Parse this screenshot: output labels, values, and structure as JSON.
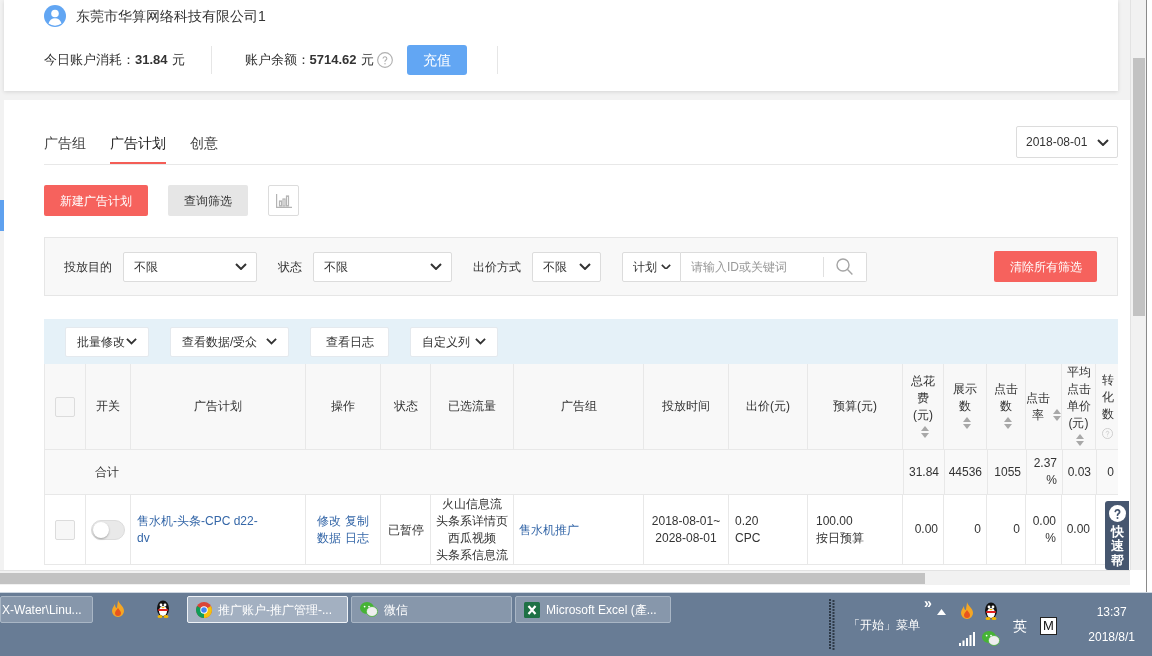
{
  "account": {
    "name": "东莞市华算网络科技有限公司1",
    "stats": [
      {
        "label": "今日账户消耗：",
        "value": "31.84",
        "unit": "元",
        "help": false
      },
      {
        "label": "账户余额：",
        "value": "5714.62",
        "unit": "元",
        "help": true
      }
    ],
    "recharge_button": "充值"
  },
  "tabs": [
    {
      "label": "广告组",
      "selected": false
    },
    {
      "label": "广告计划",
      "selected": true
    },
    {
      "label": "创意",
      "selected": false
    }
  ],
  "date_picker": {
    "value": "2018-08-01"
  },
  "action_buttons": [
    {
      "kind": "primary",
      "label": "新建广告计划"
    },
    {
      "kind": "secondary",
      "label": "查询筛选"
    },
    {
      "kind": "chart"
    }
  ],
  "filters": [
    {
      "label": "投放目的",
      "value": "不限"
    },
    {
      "label": "状态",
      "value": "不限"
    },
    {
      "label": "出价方式",
      "value": "不限"
    }
  ],
  "search": {
    "scope": "计划",
    "placeholder": "请输入ID或关键词"
  },
  "clear_filters_button": "清除所有筛选",
  "toolbar": [
    {
      "label": "批量修改",
      "dropdown": true
    },
    {
      "label": "查看数据/受众",
      "dropdown": true
    },
    {
      "label": "查看日志",
      "dropdown": false
    },
    {
      "label": "自定义列",
      "dropdown": true
    }
  ],
  "table": {
    "columns": [
      {
        "kind": "checkbox",
        "checked": false
      },
      {
        "kind": "text",
        "label": "开关",
        "sortable": false,
        "help": false
      },
      {
        "kind": "text",
        "label": "广告计划",
        "sortable": false,
        "help": false
      },
      {
        "kind": "text",
        "label": "操作",
        "sortable": false,
        "help": false
      },
      {
        "kind": "text",
        "label": "状态",
        "sortable": false,
        "help": false
      },
      {
        "kind": "text",
        "label": "已选流量",
        "sortable": false,
        "help": false
      },
      {
        "kind": "text",
        "label": "广告组",
        "sortable": false,
        "help": false
      },
      {
        "kind": "text",
        "label": "投放时间",
        "sortable": false,
        "help": false
      },
      {
        "kind": "text",
        "label": "出价(元)",
        "sortable": false,
        "help": false
      },
      {
        "kind": "text",
        "label": "预算(元)",
        "sortable": false,
        "help": false
      },
      {
        "kind": "text",
        "label": "总花费(元)",
        "sortable": true,
        "help": false
      },
      {
        "kind": "text",
        "label": "展示数",
        "sortable": true,
        "help": false
      },
      {
        "kind": "text",
        "label": "点击数",
        "sortable": true,
        "help": false
      },
      {
        "kind": "text",
        "label": "点击率",
        "sortable": true,
        "help": false
      },
      {
        "kind": "text",
        "label": "平均点击单价(元)",
        "sortable": true,
        "help": false
      },
      {
        "kind": "text",
        "label": "转化数",
        "sortable": false,
        "help": true
      }
    ],
    "total_row": {
      "label": "合计",
      "values": [
        "31.84",
        "44536",
        "1055",
        "2.37 %",
        "0.03",
        "0"
      ]
    },
    "rows": [
      {
        "checked": false,
        "enabled": false,
        "plan": "售水机-头条-CPC d22-dv",
        "operations": [
          "修改",
          "复制",
          "数据",
          "日志"
        ],
        "status": "已暂停",
        "traffic": [
          "火山信息流",
          "头条系详情页",
          "西瓜视频",
          "头条系信息流"
        ],
        "ad_group": "售水机推广",
        "schedule": [
          "2018-08-01~",
          "2028-08-01"
        ],
        "bid": [
          "0.20",
          "CPC"
        ],
        "budget": [
          "100.00",
          "按日预算"
        ],
        "metrics": [
          "0.00",
          "0",
          "0",
          "0.00 %",
          "0.00"
        ]
      }
    ]
  },
  "help_button": {
    "label": "快速帮"
  },
  "taskbar": {
    "windows": [
      {
        "kind": "other",
        "label": "X-Water\\Linu...",
        "selected": false
      },
      {
        "kind": "browser",
        "label": "推广账户-推广管理-...",
        "selected": true
      },
      {
        "kind": "chat",
        "label": "微信",
        "selected": false
      },
      {
        "kind": "spreadsheet",
        "label": "Microsoft Excel (產...",
        "selected": false
      }
    ],
    "start_menu": "「开始」菜单",
    "overflow": "»",
    "ime": "英",
    "ime_mode": "M",
    "time": "13:37",
    "date": "2018/8/1"
  }
}
